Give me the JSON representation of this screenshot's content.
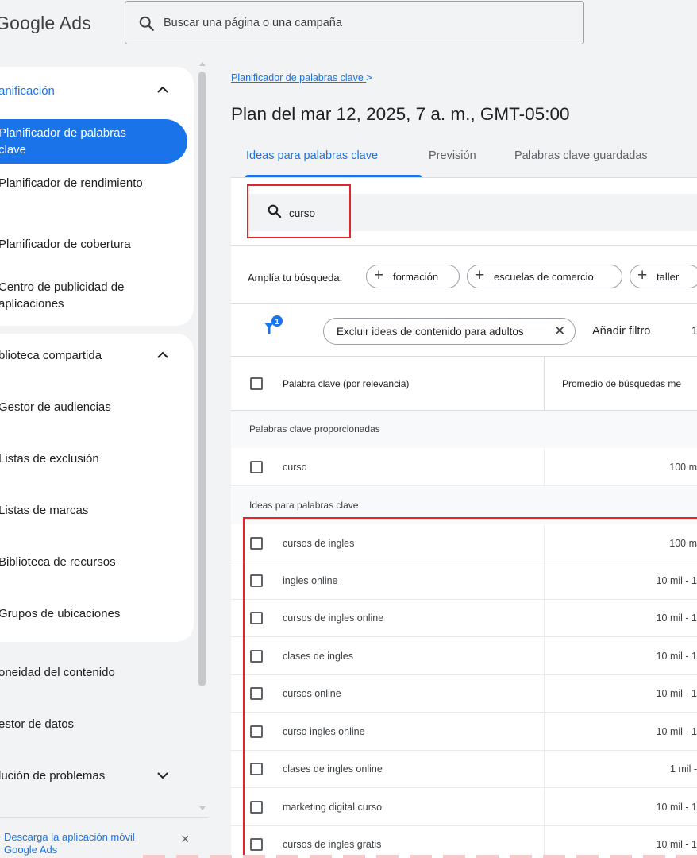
{
  "app": {
    "logo": "Google Ads",
    "search_placeholder": "Buscar una página o una campaña"
  },
  "sidebar": {
    "group1_title": "anificación",
    "group1_items": [
      {
        "label": "Planificador de palabras clave",
        "active": true
      },
      {
        "label": "Planificador de rendimiento",
        "active": false
      },
      {
        "label": "Planificador de cobertura",
        "active": false
      },
      {
        "label": "Centro de publicidad de aplicaciones",
        "active": false
      }
    ],
    "group2_title": "blioteca compartida",
    "group2_items": [
      {
        "label": "Gestor de audiencias"
      },
      {
        "label": "Listas de exclusión"
      },
      {
        "label": "Listas de marcas"
      },
      {
        "label": "Biblioteca de recursos"
      },
      {
        "label": "Grupos de ubicaciones"
      }
    ],
    "other_items": [
      {
        "label": "oneidad del contenido"
      },
      {
        "label": "estor de datos"
      },
      {
        "label": "lución de problemas"
      }
    ],
    "promo_text": "Descarga la aplicación móvil Google Ads",
    "promo_close": "×"
  },
  "main": {
    "breadcrumb": "Planificador de palabras clave",
    "breadcrumb_chevron": ">",
    "title": "Plan del mar 12, 2025, 7 a. m., GMT-05:00",
    "tabs": [
      {
        "label": "Ideas para palabras clave",
        "active": true
      },
      {
        "label": "Previsión",
        "active": false
      },
      {
        "label": "Palabras clave guardadas",
        "active": false
      }
    ],
    "keyword_input_value": "curso",
    "broaden_label": "Amplía tu búsqueda:",
    "broaden_chips": [
      "formación",
      "escuelas de comercio",
      "taller"
    ],
    "filter_badge": "1",
    "exclude_chip": "Excluir ideas de contenido para adultos",
    "add_filter": "Añadir filtro",
    "add_filter_trailing": "1",
    "columns": [
      "Palabra clave (por relevancia)",
      "Promedio de búsquedas me"
    ],
    "groups": {
      "provided": "Palabras clave proporcionadas",
      "ideas": "Ideas para palabras clave"
    },
    "provided_rows": [
      {
        "keyword": "curso",
        "volume": "100 m"
      }
    ],
    "idea_rows": [
      {
        "keyword": "cursos de ingles",
        "volume": "100 m"
      },
      {
        "keyword": "ingles online",
        "volume": "10 mil - 1"
      },
      {
        "keyword": "cursos de ingles online",
        "volume": "10 mil - 1"
      },
      {
        "keyword": "clases de ingles",
        "volume": "10 mil - 1"
      },
      {
        "keyword": "cursos online",
        "volume": "10 mil - 1"
      },
      {
        "keyword": "curso ingles online",
        "volume": "10 mil - 1"
      },
      {
        "keyword": "clases de ingles online",
        "volume": "1 mil -"
      },
      {
        "keyword": "marketing digital curso",
        "volume": "10 mil - 1"
      },
      {
        "keyword": "cursos de ingles gratis",
        "volume": "10 mil - 1"
      }
    ]
  },
  "colors": {
    "accent": "#1a73e8",
    "highlight_box": "#e3242b",
    "background": "#f1f3f4"
  }
}
